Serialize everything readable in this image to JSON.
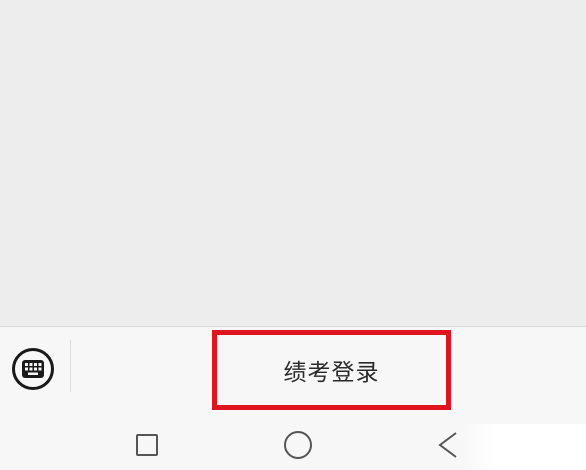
{
  "chat": {},
  "menu": {
    "keyboard_icon": "keyboard-icon",
    "items": [
      {
        "label": "绩考登录",
        "highlighted": true,
        "highlight_color": "#e0141e"
      }
    ]
  },
  "nav": {
    "recents_icon": "square-icon",
    "home_icon": "circle-icon",
    "back_icon": "back-triangle-icon"
  },
  "colors": {
    "chat_background": "#ededed",
    "menu_background": "#f7f7f7",
    "highlight": "#e0141e"
  }
}
